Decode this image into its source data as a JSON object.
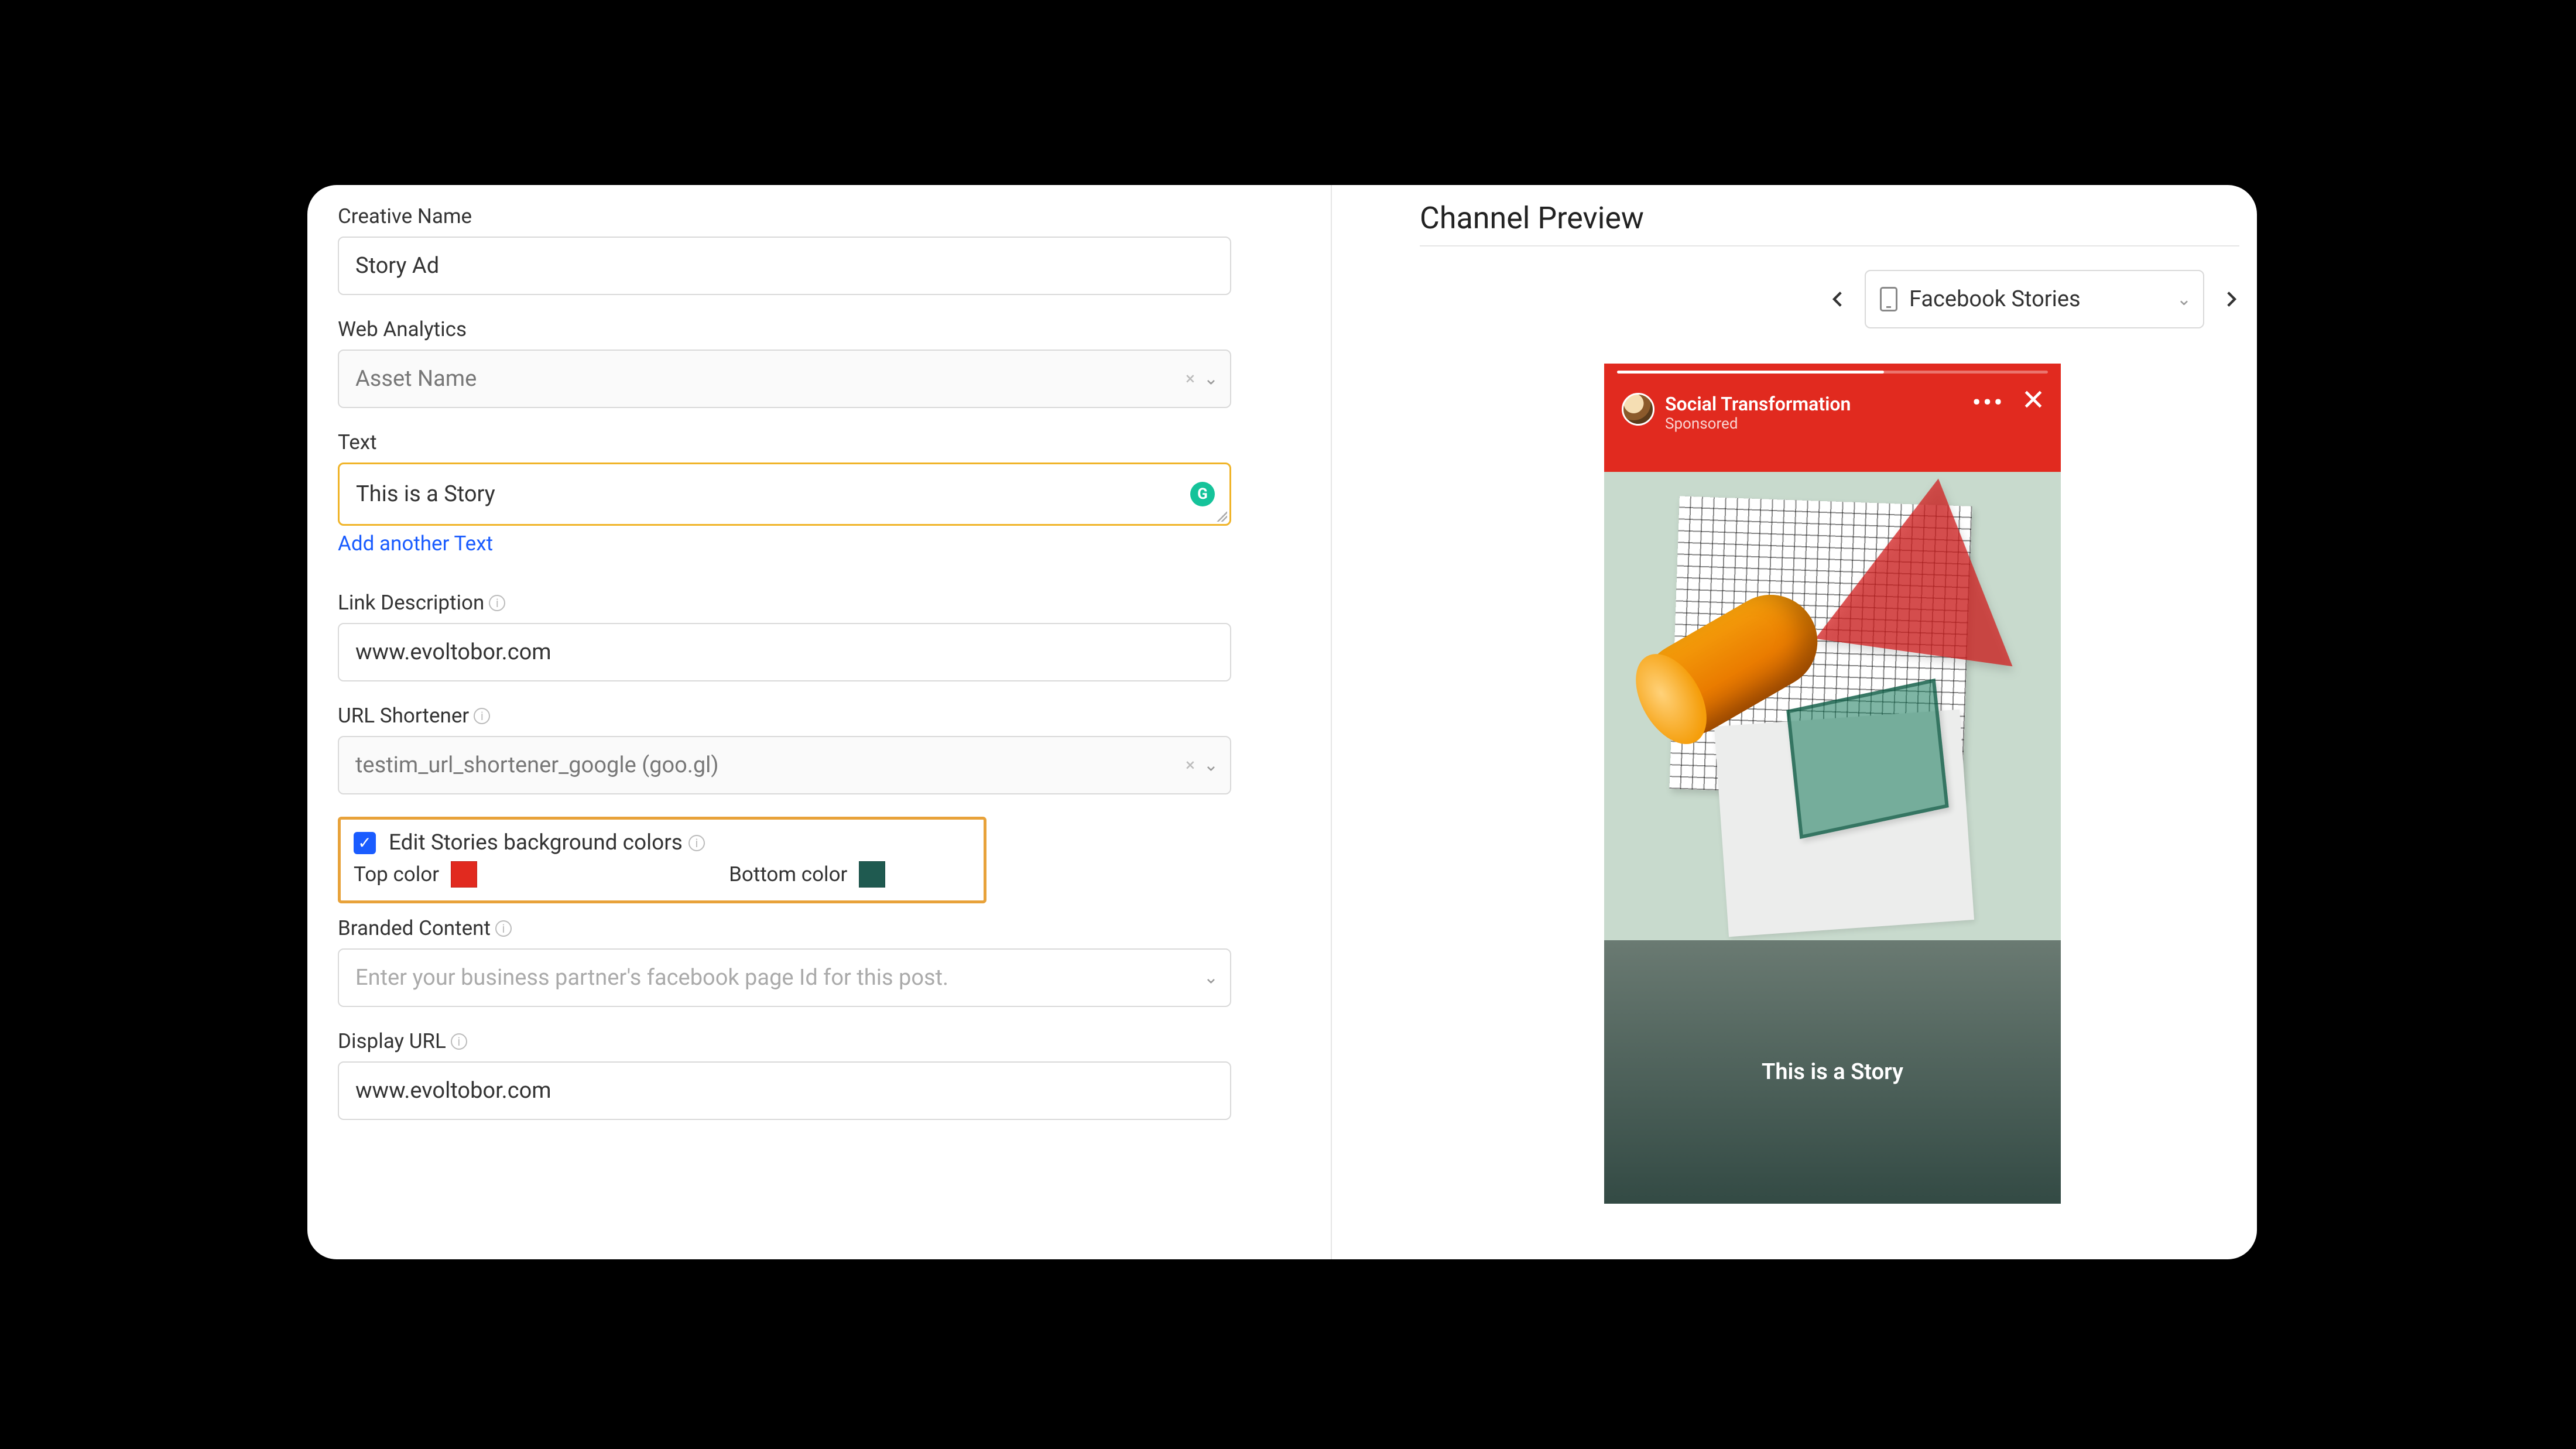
{
  "form": {
    "creativeName": {
      "label": "Creative Name",
      "value": "Story Ad"
    },
    "webAnalytics": {
      "label": "Web Analytics",
      "value": "Asset Name"
    },
    "text": {
      "label": "Text",
      "value": "This is a Story",
      "addAnother": "Add another Text"
    },
    "linkDescription": {
      "label": "Link Description",
      "value": "www.evoltobor.com"
    },
    "urlShortener": {
      "label": "URL Shortener",
      "value": "testim_url_shortener_google (goo.gl)"
    },
    "storiesColors": {
      "checkboxLabel": "Edit Stories background colors",
      "checked": true,
      "top": {
        "label": "Top color",
        "value": "#e12a1f"
      },
      "bottom": {
        "label": "Bottom color",
        "value": "#1f5a50"
      }
    },
    "brandedContent": {
      "label": "Branded Content",
      "placeholder": "Enter your business partner's facebook page Id for this post."
    },
    "displayUrl": {
      "label": "Display URL",
      "value": "www.evoltobor.com"
    }
  },
  "preview": {
    "title": "Channel Preview",
    "channelSelector": "Facebook Stories",
    "story": {
      "brand": "Social Transformation",
      "sponsored": "Sponsored",
      "caption": "This is a Story",
      "topColor": "#e12a1f",
      "bottomGradientFrom": "#6a7a72",
      "bottomGradientTo": "#334a44"
    }
  }
}
